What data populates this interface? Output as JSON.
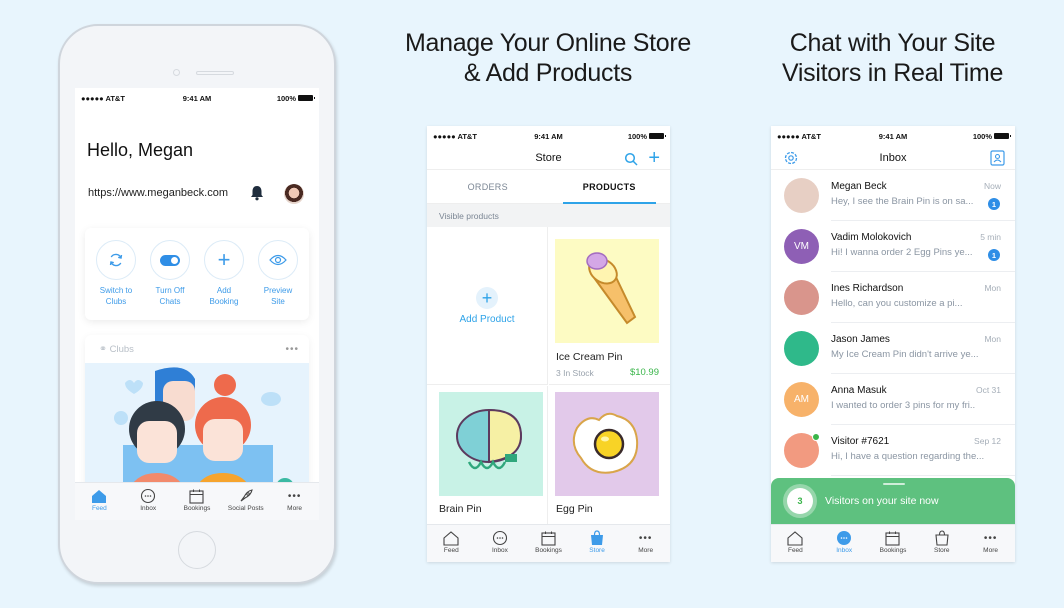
{
  "headlines": {
    "store": [
      "Manage Your Online Store",
      "& Add Products"
    ],
    "chat": [
      "Chat with Your Site",
      "Visitors in Real Time"
    ]
  },
  "status_bar": {
    "carrier": "●●●●● AT&T",
    "time": "9:41 AM",
    "battery": "100%"
  },
  "feed_screen": {
    "greeting": "Hello, Megan",
    "site_url": "https://www.meganbeck.com",
    "quick_actions": [
      {
        "icon": "sync-icon",
        "label": [
          "Switch to",
          "Clubs"
        ]
      },
      {
        "icon": "toggle-icon",
        "label": [
          "Turn Off",
          "Chats"
        ]
      },
      {
        "icon": "plus-icon",
        "label": [
          "Add",
          "Booking"
        ]
      },
      {
        "icon": "eye-icon",
        "label": [
          "Preview",
          "Site"
        ]
      }
    ],
    "clubs_card": {
      "title": "Clubs",
      "menu": "•••"
    },
    "tabs": [
      {
        "label": "Feed",
        "icon": "home-icon",
        "active": true
      },
      {
        "label": "Inbox",
        "icon": "chat-icon",
        "active": false
      },
      {
        "label": "Bookings",
        "icon": "calendar-icon",
        "active": false
      },
      {
        "label": "Social Posts",
        "icon": "rocket-icon",
        "active": false
      },
      {
        "label": "More",
        "icon": "more-icon",
        "active": false
      }
    ]
  },
  "store_screen": {
    "title": "Store",
    "segments": [
      {
        "label": "ORDERS",
        "active": false
      },
      {
        "label": "PRODUCTS",
        "active": true
      }
    ],
    "section_header": "Visible products",
    "add_product_label": "Add Product",
    "products": [
      {
        "name": "Ice Cream Pin",
        "stock": "3 In Stock",
        "price": "$10.99",
        "bg": "#fdfbc3"
      },
      {
        "name": "Brain Pin",
        "stock": "",
        "price": "",
        "bg": "#c8f2e6"
      },
      {
        "name": "Egg Pin",
        "stock": "",
        "price": "",
        "bg": "#e2c9ea"
      }
    ],
    "tabs": [
      {
        "label": "Feed",
        "icon": "home-icon",
        "active": false
      },
      {
        "label": "Inbox",
        "icon": "chat-icon",
        "active": false
      },
      {
        "label": "Bookings",
        "icon": "calendar-icon",
        "active": false
      },
      {
        "label": "Store",
        "icon": "bag-icon",
        "active": true
      },
      {
        "label": "More",
        "icon": "more-icon",
        "active": false
      }
    ]
  },
  "inbox_screen": {
    "title": "Inbox",
    "messages": [
      {
        "name": "Megan Beck",
        "preview": "Hey, I see the Brain Pin is on sa...",
        "time": "Now",
        "unread": "1",
        "initials": "",
        "color": "#e7cfc4"
      },
      {
        "name": "Vadim Molokovich",
        "preview": "Hi! I wanna order 2 Egg Pins ye...",
        "time": "5 min",
        "unread": "1",
        "initials": "VM",
        "color": "#8e5fb5"
      },
      {
        "name": "Ines Richardson",
        "preview": "Hello, can you customize a pi...",
        "time": "Mon",
        "unread": "",
        "initials": "",
        "color": "#d9958c"
      },
      {
        "name": "Jason James",
        "preview": "My Ice Cream Pin didn't arrive ye...",
        "time": "Mon",
        "unread": "",
        "initials": "",
        "color": "#2fb98a"
      },
      {
        "name": "Anna Masuk",
        "preview": "I wanted to order 3 pins for my fri..",
        "time": "Oct 31",
        "unread": "",
        "initials": "AM",
        "color": "#f7b26a"
      },
      {
        "name": "Visitor #7621",
        "preview": "Hi, I have a question regarding the...",
        "time": "Sep 12",
        "unread": "",
        "initials": "",
        "color": "#f29a80"
      }
    ],
    "visitors_banner": {
      "count": "3",
      "text": "Visitors on your site now"
    },
    "tabs": [
      {
        "label": "Feed",
        "icon": "home-icon",
        "active": false
      },
      {
        "label": "Inbox",
        "icon": "chat-icon",
        "active": true
      },
      {
        "label": "Bookings",
        "icon": "calendar-icon",
        "active": false
      },
      {
        "label": "Store",
        "icon": "bag-icon",
        "active": false
      },
      {
        "label": "More",
        "icon": "more-icon",
        "active": false
      }
    ]
  },
  "colors": {
    "accent": "#2ea3e8",
    "green": "#5ec17f",
    "price": "#3ab54a",
    "background": "#e8f5fd"
  }
}
